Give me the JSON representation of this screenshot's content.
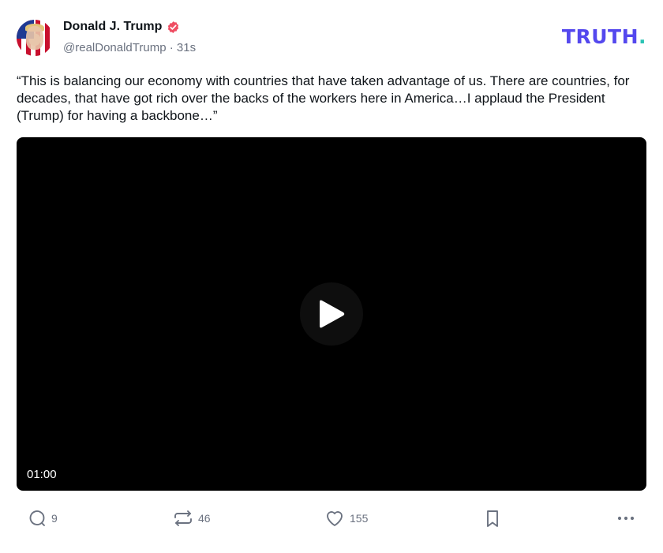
{
  "author": {
    "display_name": "Donald J. Trump",
    "handle": "@realDonaldTrump",
    "separator": "·",
    "time": "31s",
    "verified_icon": "verified-badge-icon"
  },
  "brand": {
    "name": "TRUTH",
    "dot": ".",
    "color": "#5448ee",
    "dot_color": "#2ac3b4"
  },
  "post": {
    "text": "“This is balancing our economy with countries that have taken advantage of us. There are countries, for decades, that have got rich over the backs of the workers here in America…I applaud the President (Trump) for having a backbone…”"
  },
  "video": {
    "duration": "01:00",
    "play_icon": "play-icon"
  },
  "actions": {
    "replies": "9",
    "retruths": "46",
    "likes": "155",
    "reply_icon": "comment-icon",
    "retruth_icon": "repost-icon",
    "like_icon": "heart-icon",
    "bookmark_icon": "bookmark-icon",
    "more_icon": "more-dots-icon"
  },
  "colors": {
    "accent_verified": "#ef4e63",
    "muted": "#6b7280"
  }
}
